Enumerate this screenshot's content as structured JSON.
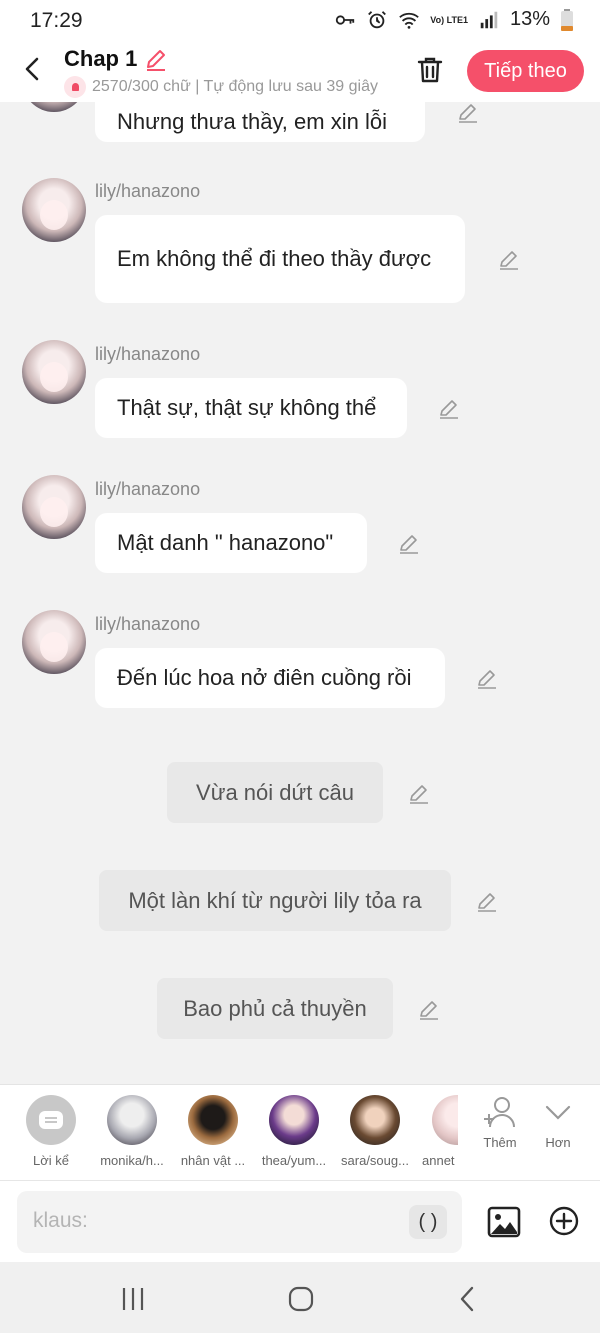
{
  "status_bar": {
    "time": "17:29",
    "network": "Vo) LTE1",
    "battery": "13%"
  },
  "header": {
    "title": "Chap 1",
    "subtitle": "2570/300 chữ | Tự động lưu sau 39 giây",
    "next_label": "Tiếp theo"
  },
  "messages": [
    {
      "name": "lily/hanazono",
      "text": "Nhưng thưa thầy, em xin lỗi"
    },
    {
      "name": "lily/hanazono",
      "text": "Em không thể đi theo thầy được"
    },
    {
      "name": "lily/hanazono",
      "text": "Thật sự, thật sự không thể"
    },
    {
      "name": "lily/hanazono",
      "text": "Mật danh \" hanazono\""
    },
    {
      "name": "lily/hanazono",
      "text": "Đến lúc hoa nở điên cuồng rồi"
    }
  ],
  "narrations": [
    {
      "text": "Vừa nói dứt câu"
    },
    {
      "text": "Một làn khí từ người lily tỏa ra"
    },
    {
      "text": "Bao phủ cả thuyền"
    }
  ],
  "characters": [
    {
      "label": "Lời kể"
    },
    {
      "label": "monika/h..."
    },
    {
      "label": "nhân vật ..."
    },
    {
      "label": "thea/yum..."
    },
    {
      "label": "sara/soug..."
    },
    {
      "label": "annet"
    },
    {
      "label": "Thêm"
    },
    {
      "label": "Hơn"
    }
  ],
  "input": {
    "placeholder": "klaus:",
    "paren_label": "( )"
  },
  "colors": {
    "accent": "#f5506a",
    "bubble": "#ffffff",
    "narration": "#e8e8e8",
    "background": "#f2f2f2"
  }
}
